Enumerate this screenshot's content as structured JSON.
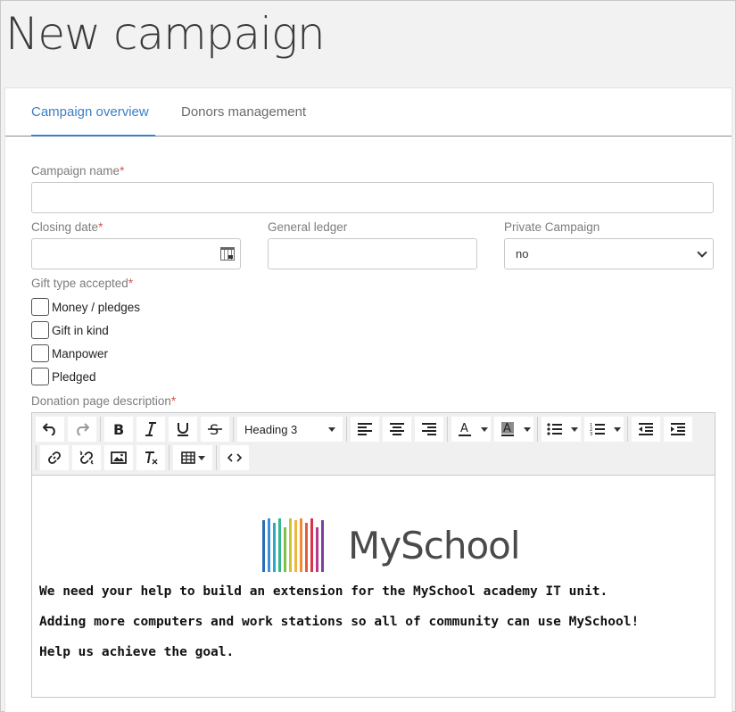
{
  "page": {
    "title": "New campaign"
  },
  "tabs": [
    {
      "label": "Campaign overview",
      "active": true
    },
    {
      "label": "Donors management",
      "active": false
    }
  ],
  "form": {
    "campaign_name": {
      "label": "Campaign name",
      "required_mark": "*",
      "value": ""
    },
    "closing_date": {
      "label": "Closing date",
      "required_mark": "*",
      "value": ""
    },
    "general_ledger": {
      "label": "General ledger",
      "value": ""
    },
    "private_campaign": {
      "label": "Private Campaign",
      "value": "no"
    },
    "gift_type": {
      "label": "Gift type accepted",
      "required_mark": "*",
      "options": [
        "Money / pledges",
        "Gift in kind",
        "Manpower",
        "Pledged"
      ]
    },
    "description": {
      "label": "Donation page description",
      "required_mark": "*"
    }
  },
  "editor": {
    "block_format": "Heading 3",
    "toolbar_icons": [
      "undo-icon",
      "redo-icon",
      "bold-icon",
      "italic-icon",
      "underline-icon",
      "strikethrough-icon",
      "align-left-icon",
      "align-center-icon",
      "align-right-icon",
      "text-color-icon",
      "background-color-icon",
      "bullet-list-icon",
      "numbered-list-icon",
      "outdent-icon",
      "indent-icon",
      "link-icon",
      "unlink-icon",
      "image-icon",
      "clear-formatting-icon",
      "table-icon",
      "source-code-icon"
    ],
    "logo_text": "MySchool",
    "logo_colors": [
      "#2e6db5",
      "#3a8fd6",
      "#2fa7c9",
      "#34b88c",
      "#7cc242",
      "#c9c63a",
      "#f0b53c",
      "#ef8a3a",
      "#e45b3b",
      "#d7354a",
      "#b53a8c",
      "#7c3fa0"
    ],
    "paragraphs": [
      "We need your help to build an extension for the MySchool academy IT unit.",
      "Adding more computers and work stations so all of community can use MySchool!",
      "Help us achieve the goal."
    ]
  }
}
